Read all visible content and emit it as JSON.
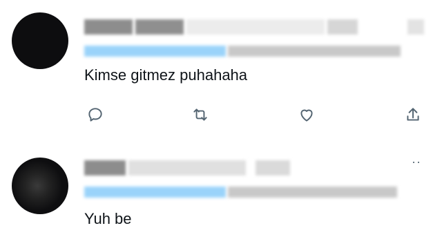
{
  "replies": [
    {
      "text": "Kimse gitmez puhahaha",
      "actions": [
        "reply-icon",
        "retweet-icon",
        "like-icon",
        "share-icon"
      ]
    },
    {
      "text": "Yuh be",
      "more_label": "··"
    }
  ],
  "colors": {
    "text": "#0f1419",
    "icon": "#536471",
    "handle_blue": "#8ecdf8"
  }
}
